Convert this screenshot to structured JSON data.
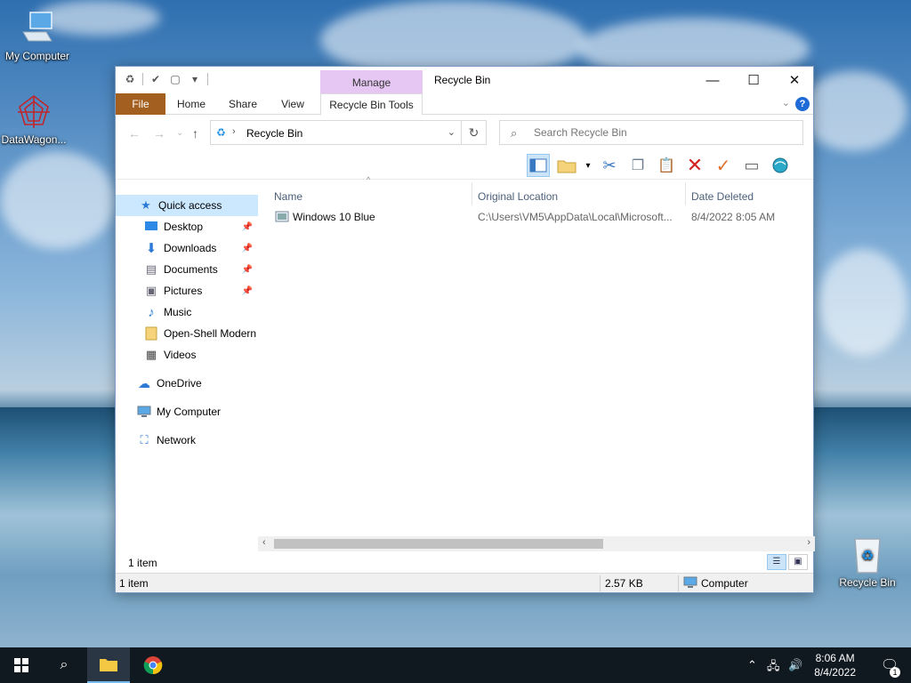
{
  "desktop": {
    "icons": [
      {
        "label": "My Computer"
      },
      {
        "label": "DataWagon..."
      },
      {
        "label": "Recycle Bin"
      }
    ]
  },
  "window": {
    "title": "Recycle Bin",
    "contextual_group": "Manage",
    "tabs": {
      "file": "File",
      "home": "Home",
      "share": "Share",
      "view": "View",
      "tools": "Recycle Bin Tools"
    },
    "help_label": "?",
    "address": {
      "path": "Recycle Bin"
    },
    "search": {
      "placeholder": "Search Recycle Bin"
    },
    "nav": {
      "quick_access": "Quick access",
      "items": [
        {
          "label": "Desktop",
          "pinned": true
        },
        {
          "label": "Downloads",
          "pinned": true
        },
        {
          "label": "Documents",
          "pinned": true
        },
        {
          "label": "Pictures",
          "pinned": true
        },
        {
          "label": "Music",
          "pinned": false
        },
        {
          "label": "Open-Shell Modern",
          "pinned": false
        },
        {
          "label": "Videos",
          "pinned": false
        }
      ],
      "onedrive": "OneDrive",
      "my_computer": "My Computer",
      "network": "Network"
    },
    "columns": {
      "name": "Name",
      "original_location": "Original Location",
      "date_deleted": "Date Deleted"
    },
    "rows": [
      {
        "name": "Windows 10 Blue",
        "original_location": "C:\\Users\\VM5\\AppData\\Local\\Microsoft...",
        "date_deleted": "8/4/2022 8:05 AM"
      }
    ],
    "item_count": "1 item",
    "status": {
      "items": "1 item",
      "size": "2.57 KB",
      "location": "Computer"
    }
  },
  "taskbar": {
    "time": "8:06 AM",
    "date": "8/4/2022",
    "notification_count": "1"
  },
  "colors": {
    "file_tab": "#a35f1f",
    "manage_tab": "#e6c6f2",
    "selection": "#cce8ff",
    "taskbar": "#101820"
  }
}
